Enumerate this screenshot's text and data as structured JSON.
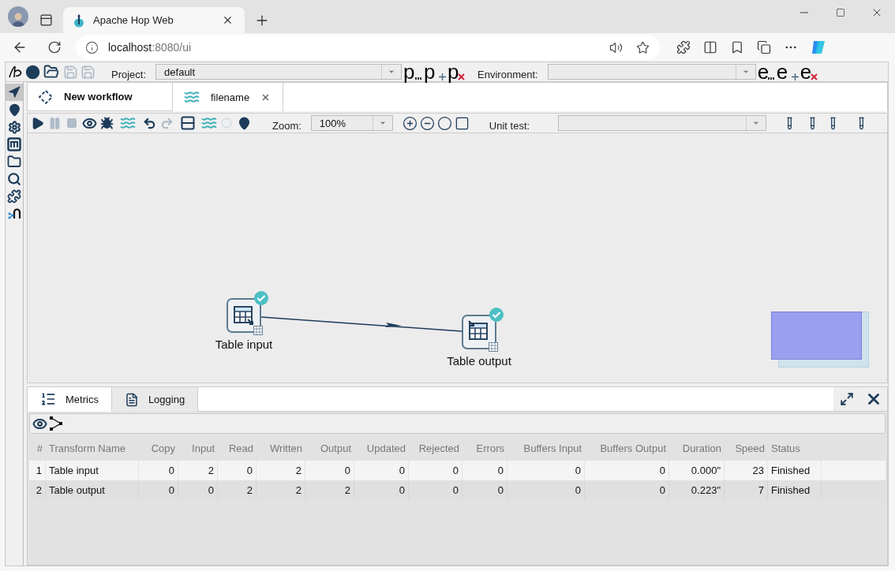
{
  "browser": {
    "tab_title": "Apache Hop Web",
    "url_host": "localhost",
    "url_path": ":8080/ui"
  },
  "app_toolbar": {
    "project_label": "Project:",
    "project_value": "default",
    "project_buttons": [
      {
        "letter": "p",
        "kind": "edit"
      },
      {
        "letter": "p",
        "kind": "add"
      },
      {
        "letter": "p",
        "kind": "delete"
      }
    ],
    "environment_label": "Environment:",
    "environment_buttons": [
      {
        "letter": "e",
        "kind": "edit"
      },
      {
        "letter": "e",
        "kind": "add"
      },
      {
        "letter": "e",
        "kind": "delete"
      }
    ]
  },
  "sidebar": {
    "items": [
      {
        "selected": true
      },
      {
        "selected": false
      },
      {
        "selected": false
      },
      {
        "selected": false
      },
      {
        "selected": false
      },
      {
        "selected": false
      },
      {
        "selected": false
      },
      {
        "selected": false
      }
    ]
  },
  "file_tabs": [
    {
      "label": "New workflow",
      "kind": "action",
      "selected": false,
      "closable": false
    },
    {
      "label": "filename",
      "kind": "pipeline",
      "selected": true,
      "closable": true
    }
  ],
  "pipeline_toolbar": {
    "zoom_label": "Zoom:",
    "zoom_value": "100%",
    "unit_test_label": "Unit test:"
  },
  "canvas": {
    "nodes": [
      {
        "label": "Table input",
        "kind": "input",
        "finished": true
      },
      {
        "label": "Table output",
        "kind": "output",
        "finished": true
      }
    ]
  },
  "bottom_panel": {
    "tabs": [
      {
        "label": "Metrics",
        "kind": "metrics",
        "selected": true
      },
      {
        "label": "Logging",
        "kind": "logging",
        "selected": false
      }
    ],
    "table": {
      "columns": [
        "#",
        "Transform Name",
        "Copy",
        "Input",
        "Read",
        "Written",
        "Output",
        "Updated",
        "Rejected",
        "Errors",
        "Buffers Input",
        "Buffers Output",
        "Duration",
        "Speed",
        "Status"
      ],
      "rows": [
        [
          "1",
          "Table input",
          "0",
          "2",
          "0",
          "2",
          "0",
          "0",
          "0",
          "0",
          "0",
          "0",
          "0.000\"",
          "23",
          "Finished"
        ],
        [
          "2",
          "Table output",
          "0",
          "0",
          "2",
          "2",
          "2",
          "0",
          "0",
          "0",
          "0",
          "0",
          "0.223\"",
          "7",
          "Finished"
        ]
      ]
    }
  }
}
